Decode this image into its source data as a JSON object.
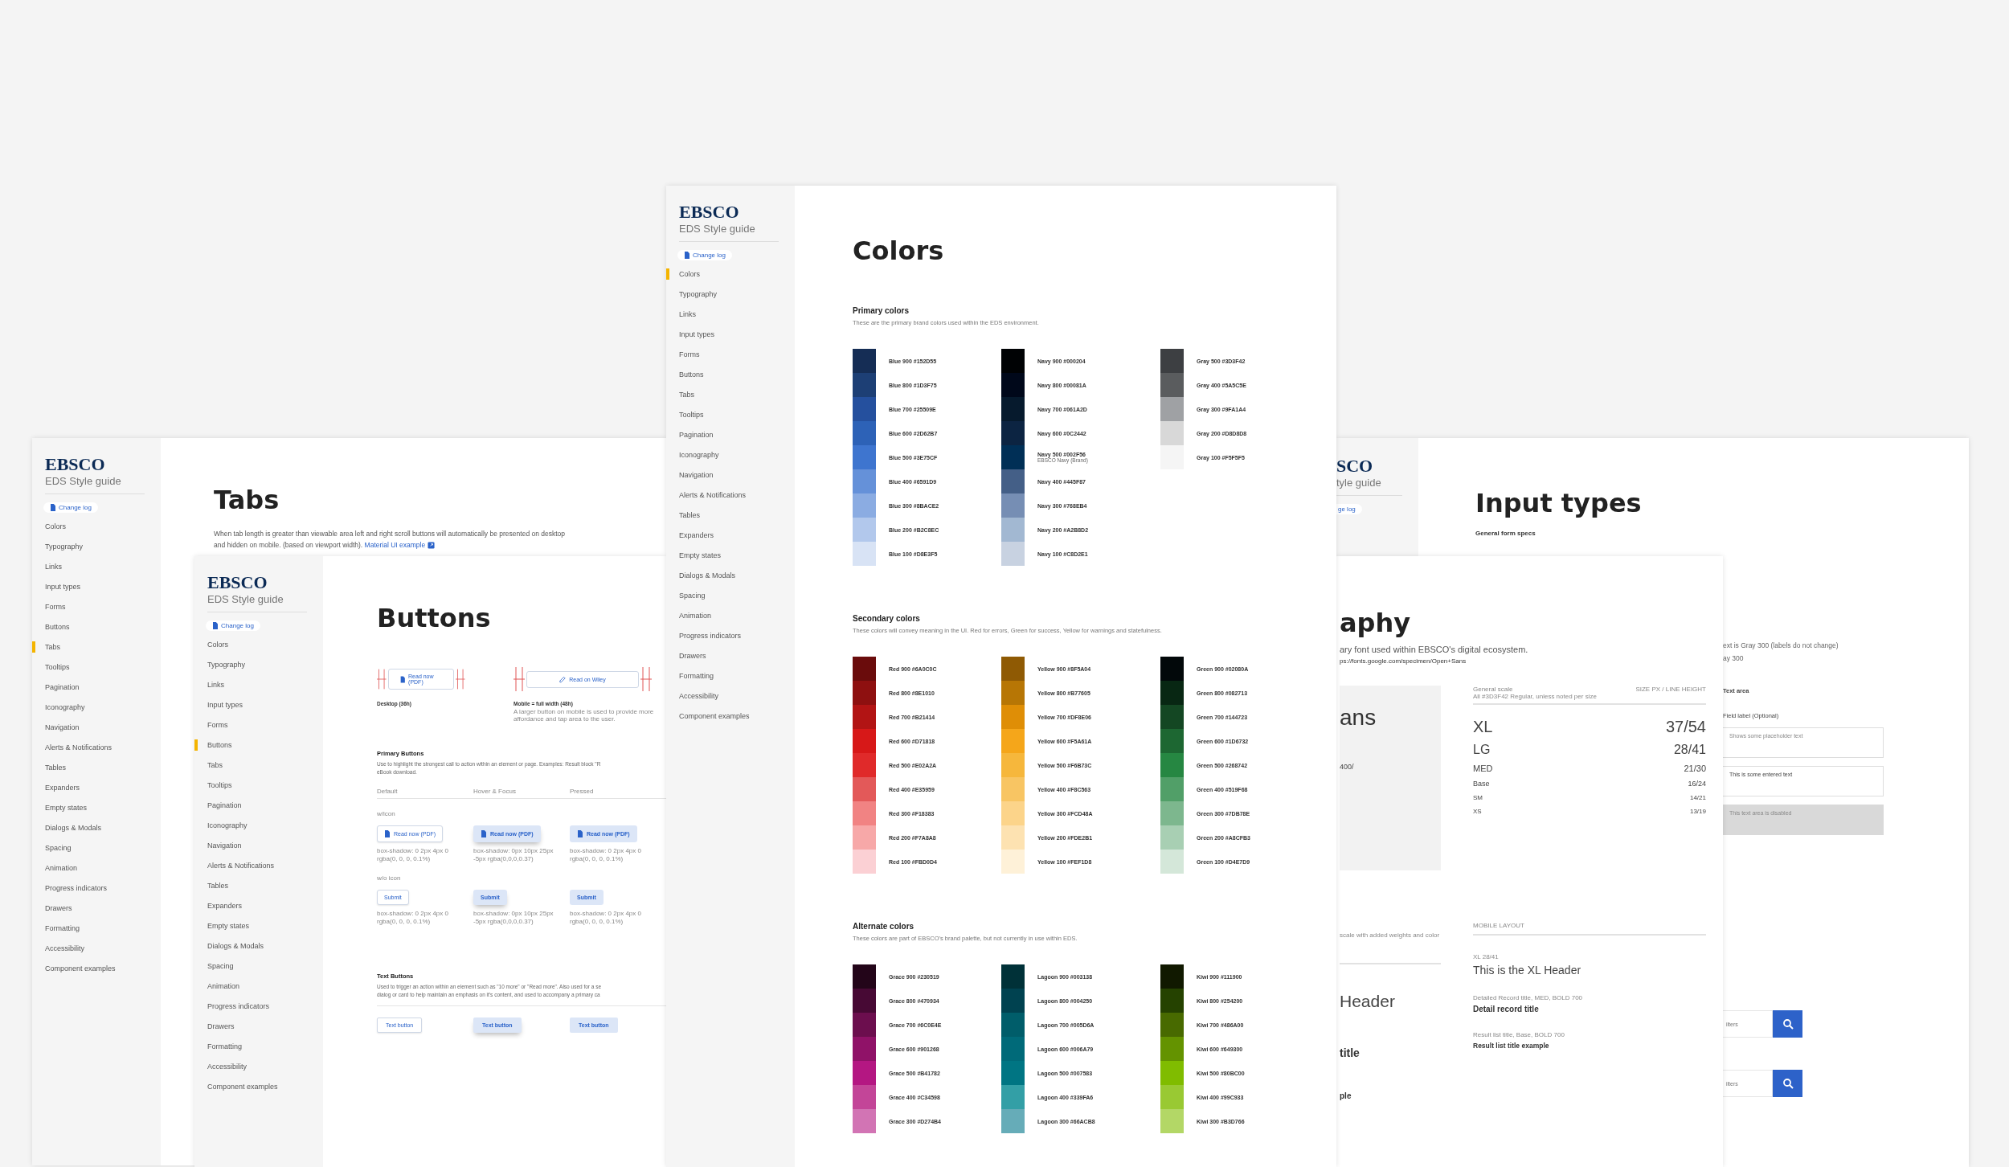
{
  "pages": [
    {
      "kind": "tabs",
      "sidebar": {
        "logo": "EBSCO",
        "subtitle": "EDS Style guide",
        "changelog": "Change log",
        "items": [
          {
            "label": "Colors",
            "selected": false
          },
          {
            "label": "Typography",
            "selected": false
          },
          {
            "label": "Links",
            "selected": false
          },
          {
            "label": "Input types",
            "selected": false
          },
          {
            "label": "Forms",
            "selected": false
          },
          {
            "label": "Buttons",
            "selected": false
          },
          {
            "label": "Tabs",
            "selected": true
          },
          {
            "label": "Tooltips",
            "selected": false
          },
          {
            "label": "Pagination",
            "selected": false
          },
          {
            "label": "Iconography",
            "selected": false
          },
          {
            "label": "Navigation",
            "selected": false
          },
          {
            "label": "Alerts & Notifications",
            "selected": false
          },
          {
            "label": "Tables",
            "selected": false
          },
          {
            "label": "Expanders",
            "selected": false
          },
          {
            "label": "Empty states",
            "selected": false
          },
          {
            "label": "Dialogs & Modals",
            "selected": false
          },
          {
            "label": "Spacing",
            "selected": false
          },
          {
            "label": "Animation",
            "selected": false
          },
          {
            "label": "Progress indicators",
            "selected": false
          },
          {
            "label": "Drawers",
            "selected": false
          },
          {
            "label": "Formatting",
            "selected": false
          },
          {
            "label": "Accessibility",
            "selected": false
          },
          {
            "label": "Component examples",
            "selected": false
          }
        ]
      },
      "title": "Tabs",
      "intro": "When tab length is greater than viewable area left and right scroll buttons will automatically be presented on desktop and hidden on mobile. (based on viewport width).",
      "link": "Material UI example"
    },
    {
      "kind": "buttons",
      "sidebar": {
        "logo": "EBSCO",
        "subtitle": "EDS Style guide",
        "changelog": "Change log",
        "items": [
          {
            "label": "Colors",
            "selected": false
          },
          {
            "label": "Typography",
            "selected": false
          },
          {
            "label": "Links",
            "selected": false
          },
          {
            "label": "Input types",
            "selected": false
          },
          {
            "label": "Forms",
            "selected": false
          },
          {
            "label": "Buttons",
            "selected": true
          },
          {
            "label": "Tabs",
            "selected": false
          },
          {
            "label": "Tooltips",
            "selected": false
          },
          {
            "label": "Pagination",
            "selected": false
          },
          {
            "label": "Iconography",
            "selected": false
          },
          {
            "label": "Navigation",
            "selected": false
          },
          {
            "label": "Alerts & Notifications",
            "selected": false
          },
          {
            "label": "Tables",
            "selected": false
          },
          {
            "label": "Expanders",
            "selected": false
          },
          {
            "label": "Empty states",
            "selected": false
          },
          {
            "label": "Dialogs & Modals",
            "selected": false
          },
          {
            "label": "Spacing",
            "selected": false
          },
          {
            "label": "Animation",
            "selected": false
          },
          {
            "label": "Progress indicators",
            "selected": false
          },
          {
            "label": "Drawers",
            "selected": false
          },
          {
            "label": "Formatting",
            "selected": false
          },
          {
            "label": "Accessibility",
            "selected": false
          },
          {
            "label": "Component examples",
            "selected": false
          }
        ]
      },
      "title": "Buttons",
      "specs": [
        {
          "label": "Read now (PDF)",
          "caption": "Desktop (36h)"
        },
        {
          "label": "Read on Wiley",
          "caption": "Mobile = full width (48h)",
          "note": "A larger button on mobile is used to provide more affordance and tap area to the user."
        }
      ],
      "primary": {
        "heading": "Primary Buttons",
        "text": "Use to highlight the strongest call to action within an element or page. Examples: Result block \"R",
        "text_end": "eBook download.",
        "columns": [
          "Default",
          "Hover & Focus",
          "Pressed"
        ],
        "groups": [
          {
            "label": "w/icon",
            "buttons": [
              {
                "kind": "default",
                "label": "Read now (PDF)",
                "caption": "box-shadow: 0 2px 4px 0 rgba(0, 0, 0, 0.1%)"
              },
              {
                "kind": "hover",
                "label": "Read now (PDF)",
                "caption": "box-shadow: 0px 10px 25px -5px rgba(0,0,0,0.37)"
              },
              {
                "kind": "pressed",
                "label": "Read now (PDF)",
                "caption": "box-shadow: 0 2px 4px 0 rgba(0, 0, 0, 0.1%)"
              }
            ]
          },
          {
            "label": "w/o icon",
            "buttons": [
              {
                "kind": "default",
                "label": "Submit",
                "caption": "box-shadow: 0 2px 4px 0 rgba(0, 0, 0, 0.1%)"
              },
              {
                "kind": "hover",
                "label": "Submit",
                "caption": "box-shadow: 0px 10px 25px -5px rgba(0,0,0,0.37)"
              },
              {
                "kind": "pressed",
                "label": "Submit",
                "caption": "box-shadow: 0 2px 4px 0 rgba(0, 0, 0, 0.1%)"
              }
            ]
          }
        ]
      },
      "text_buttons": {
        "heading": "Text Buttons",
        "text": "Used to trigger an action within an element such as \"10 more\" or \"Read more\". Also used for a se",
        "text_end": "dialog or card to help maintain an emphasis on it's content, and used to accompany a primary ca",
        "buttons": [
          {
            "kind": "default",
            "label": "Text button"
          },
          {
            "kind": "hover",
            "label": "Text button"
          },
          {
            "kind": "pressed",
            "label": "Text button"
          }
        ]
      }
    },
    {
      "kind": "colors",
      "sidebar": {
        "logo": "EBSCO",
        "subtitle": "EDS Style guide",
        "changelog": "Change log",
        "items": [
          {
            "label": "Colors",
            "selected": true
          },
          {
            "label": "Typography",
            "selected": false
          },
          {
            "label": "Links",
            "selected": false
          },
          {
            "label": "Input types",
            "selected": false
          },
          {
            "label": "Forms",
            "selected": false
          },
          {
            "label": "Buttons",
            "selected": false
          },
          {
            "label": "Tabs",
            "selected": false
          },
          {
            "label": "Tooltips",
            "selected": false
          },
          {
            "label": "Pagination",
            "selected": false
          },
          {
            "label": "Iconography",
            "selected": false
          },
          {
            "label": "Navigation",
            "selected": false
          },
          {
            "label": "Alerts & Notifications",
            "selected": false
          },
          {
            "label": "Tables",
            "selected": false
          },
          {
            "label": "Expanders",
            "selected": false
          },
          {
            "label": "Empty states",
            "selected": false
          },
          {
            "label": "Dialogs & Modals",
            "selected": false
          },
          {
            "label": "Spacing",
            "selected": false
          },
          {
            "label": "Animation",
            "selected": false
          },
          {
            "label": "Progress indicators",
            "selected": false
          },
          {
            "label": "Drawers",
            "selected": false
          },
          {
            "label": "Formatting",
            "selected": false
          },
          {
            "label": "Accessibility",
            "selected": false
          },
          {
            "label": "Component examples",
            "selected": false
          }
        ]
      },
      "title": "Colors",
      "sections": [
        {
          "heading": "Primary colors",
          "text": "These are the primary brand colors used within the EDS environment.",
          "columns": [
            [
              {
                "label": "Blue 900 #152D55",
                "color": "#152d55"
              },
              {
                "label": "Blue 800 #1D3F75",
                "color": "#1d3f75"
              },
              {
                "label": "Blue 700 #25509E",
                "color": "#25509e"
              },
              {
                "label": "Blue 600 #2D62B7",
                "color": "#2d62b7"
              },
              {
                "label": "Blue 500 #3E75CF",
                "color": "#3e75cf"
              },
              {
                "label": "Blue 400 #6591D9",
                "color": "#6591d9"
              },
              {
                "label": "Blue 300 #8BACE2",
                "color": "#8bace2"
              },
              {
                "label": "Blue 200 #B2C8EC",
                "color": "#b2c8ec"
              },
              {
                "label": "Blue 100 #D8E3F5",
                "color": "#d8e3f5"
              }
            ],
            [
              {
                "label": "Navy 900 #000204",
                "color": "#000204"
              },
              {
                "label": "Navy 800 #00081A",
                "color": "#00081a"
              },
              {
                "label": "Navy 700 #061A2D",
                "color": "#061a2d"
              },
              {
                "label": "Navy 600 #0C2442",
                "color": "#0c2442"
              },
              {
                "label": "Navy 500 #002F56",
                "color": "#002f56",
                "note": "EBSCO Navy (Brand)"
              },
              {
                "label": "Navy 400 #445F87",
                "color": "#445f87"
              },
              {
                "label": "Navy 300 #768EB4",
                "color": "#768eb4"
              },
              {
                "label": "Navy 200 #A2B8D2",
                "color": "#a2b8d2"
              },
              {
                "label": "Navy 100 #C8D2E1",
                "color": "#c8d2e1"
              }
            ],
            [
              {
                "label": "Gray 500 #3D3F42",
                "color": "#3d3f42"
              },
              {
                "label": "Gray 400 #5A5C5E",
                "color": "#5a5c5e"
              },
              {
                "label": "Gray 300 #9FA1A4",
                "color": "#9fa1a4"
              },
              {
                "label": "Gray 200 #D8D8D8",
                "color": "#d8d8d8"
              },
              {
                "label": "Gray 100 #F5F5F5",
                "color": "#f5f5f5"
              }
            ]
          ]
        },
        {
          "heading": "Secondary colors",
          "text": "These colors will convey meaning in the UI. Red for errors, Green for success, Yellow for warnings and statefulness.",
          "columns": [
            [
              {
                "label": "Red 900 #6A0C0C",
                "color": "#6a0c0c"
              },
              {
                "label": "Red 800 #8E1010",
                "color": "#8e1010"
              },
              {
                "label": "Red 700 #B21414",
                "color": "#b21414"
              },
              {
                "label": "Red 600 #D71818",
                "color": "#d71818"
              },
              {
                "label": "Red 500 #E02A2A",
                "color": "#e02a2a"
              },
              {
                "label": "Red 400 #E35959",
                "color": "#e35959"
              },
              {
                "label": "Red 300 #F18383",
                "color": "#f18383"
              },
              {
                "label": "Red 200 #F7A8A8",
                "color": "#f7a8a8"
              },
              {
                "label": "Red 100 #FBD0D4",
                "color": "#fbd0d4"
              }
            ],
            [
              {
                "label": "Yellow 900 #8F5A04",
                "color": "#8f5a04"
              },
              {
                "label": "Yellow 800 #B77605",
                "color": "#b77605"
              },
              {
                "label": "Yellow 700 #DF8E06",
                "color": "#df8e06"
              },
              {
                "label": "Yellow 600 #F5A61A",
                "color": "#f5a61a"
              },
              {
                "label": "Yellow 500 #F6B73C",
                "color": "#f6b73c"
              },
              {
                "label": "Yellow 400 #F8C563",
                "color": "#f8c563"
              },
              {
                "label": "Yellow 300 #FCD48A",
                "color": "#fcd48a"
              },
              {
                "label": "Yellow 200 #FDE2B1",
                "color": "#fde2b1"
              },
              {
                "label": "Yellow 100 #FEF1D8",
                "color": "#fef1d8"
              }
            ],
            [
              {
                "label": "Green 900 #02080A",
                "color": "#02080a"
              },
              {
                "label": "Green 800 #082713",
                "color": "#082713"
              },
              {
                "label": "Green 700 #144723",
                "color": "#144723"
              },
              {
                "label": "Green 600 #1D6732",
                "color": "#1d6732"
              },
              {
                "label": "Green 500 #268742",
                "color": "#268742"
              },
              {
                "label": "Green 400 #519F68",
                "color": "#519f68"
              },
              {
                "label": "Green 300 #7DB78E",
                "color": "#7db78e"
              },
              {
                "label": "Green 200 #A8CFB3",
                "color": "#a8cfb3"
              },
              {
                "label": "Green 100 #D4E7D9",
                "color": "#d4e7d9"
              }
            ]
          ]
        },
        {
          "heading": "Alternate colors",
          "text": "These colors are part of EBSCO's brand palette, but not currently in use within EDS.",
          "columns": [
            [
              {
                "label": "Grace 900 #230519",
                "color": "#230519"
              },
              {
                "label": "Grace 800 #470934",
                "color": "#470934"
              },
              {
                "label": "Grace 700 #6C0E4E",
                "color": "#6c0e4e"
              },
              {
                "label": "Grace 600 #901268",
                "color": "#901268"
              },
              {
                "label": "Grace 500 #B41782",
                "color": "#b41782"
              },
              {
                "label": "Grace 400 #C34598",
                "color": "#c34598"
              },
              {
                "label": "Grace 300 #D274B4",
                "color": "#d274b4"
              }
            ],
            [
              {
                "label": "Lagoon 900 #003138",
                "color": "#003138"
              },
              {
                "label": "Lagoon 800 #004250",
                "color": "#004250"
              },
              {
                "label": "Lagoon 700 #005D6A",
                "color": "#005d6a"
              },
              {
                "label": "Lagoon 600 #006A79",
                "color": "#006a79"
              },
              {
                "label": "Lagoon 500 #007583",
                "color": "#007583"
              },
              {
                "label": "Lagoon 400 #339FA6",
                "color": "#339fa6"
              },
              {
                "label": "Lagoon 300 #66ACB8",
                "color": "#66acb8"
              }
            ],
            [
              {
                "label": "Kiwi 900 #111900",
                "color": "#111900"
              },
              {
                "label": "Kiwi 800 #254200",
                "color": "#254200"
              },
              {
                "label": "Kiwi 700 #486A00",
                "color": "#486a00"
              },
              {
                "label": "Kiwi 600 #649300",
                "color": "#649300"
              },
              {
                "label": "Kiwi 500 #80BC00",
                "color": "#80bc00"
              },
              {
                "label": "Kiwi 400 #99C933",
                "color": "#99c933"
              },
              {
                "label": "Kiwi 300 #B3D766",
                "color": "#b3d766"
              }
            ]
          ]
        }
      ]
    },
    {
      "kind": "input_types",
      "sidebar": {
        "logo": "SCO",
        "subtitle": "tyle guide",
        "changelog": "ge log"
      },
      "title": "Input types",
      "subtitle": "General form specs",
      "notes": [
        "ext is Gray 300 (labels do not change)",
        "ay 300"
      ],
      "section": "Text area",
      "field_label": "Field label (Optional)",
      "fields": [
        {
          "placeholder": "Shows some placeholder text",
          "disabled": false
        },
        {
          "value": "This is some entered text",
          "disabled": false
        },
        {
          "placeholder": "This text area is disabled",
          "disabled": true
        }
      ],
      "searches": [
        {
          "placeholder": "ilters"
        },
        {
          "placeholder": "ilters"
        }
      ]
    },
    {
      "kind": "typography",
      "title": "aphy",
      "text": "ary font used within EBSCO's digital ecosystem.",
      "url": "ps://fonts.google.com/specimen/Open+Sans",
      "font_name": "ans",
      "font_weights": "400/",
      "scale": {
        "heading": "General scale",
        "note": "All #3D3F42 Regular, unless noted per size",
        "unit": "SIZE PX / LINE HEIGHT",
        "rows": [
          {
            "size": "XL",
            "value": "37/54"
          },
          {
            "size": "LG",
            "value": "28/41"
          },
          {
            "size": "MED",
            "value": "21/30"
          },
          {
            "size": "Base",
            "value": "16/24"
          },
          {
            "size": "SM",
            "value": "14/21"
          },
          {
            "size": "XS",
            "value": "13/19"
          }
        ]
      },
      "left_note": "scale with added weights and color",
      "layout_heading": "MOBILE LAYOUT",
      "examples": [
        {
          "kind": "xl",
          "left": "Header",
          "caption": "XL 28/41",
          "sample": "This is the XL Header"
        },
        {
          "kind": "med",
          "left": "title",
          "caption": "Detailed Record title, MED, BOLD 700",
          "sample": "Detail record title"
        },
        {
          "kind": "base",
          "left": "ple",
          "caption": "Result list title, Base, BOLD 700",
          "sample": "Result list title example"
        }
      ]
    }
  ]
}
